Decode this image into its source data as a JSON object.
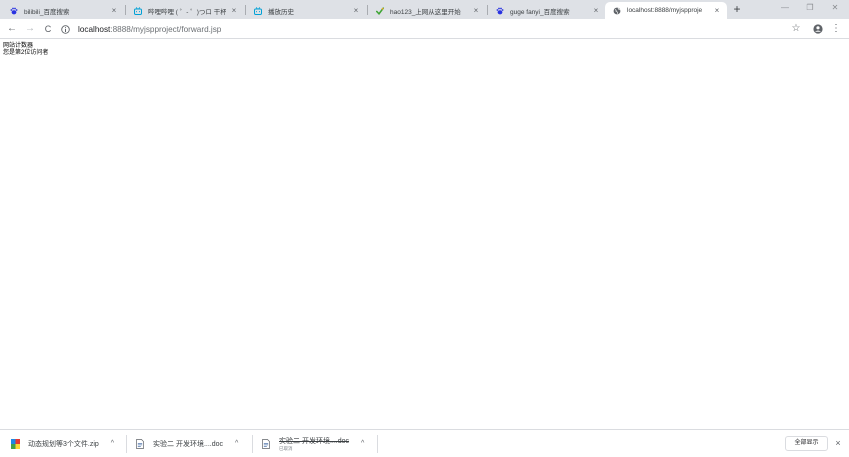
{
  "tabs": [
    {
      "title": "bilibili_百度搜索",
      "icon": "baidu-paw-icon"
    },
    {
      "title": "哔哩哔哩 ( ゜- ゜)つロ 干杯~",
      "icon": "bilibili-tv-icon"
    },
    {
      "title": "播放历史",
      "icon": "bilibili-tv-icon"
    },
    {
      "title": "hao123_上网从这里开始",
      "icon": "hao123-icon"
    },
    {
      "title": "guge fanyi_百度搜索",
      "icon": "baidu-paw-icon"
    },
    {
      "title": "localhost:8888/myjspproje",
      "icon": "globe-icon"
    }
  ],
  "tab_close_glyph": "×",
  "new_tab_glyph": "+",
  "window_controls": {
    "minimize": "—",
    "restore": "❐",
    "close": "✕"
  },
  "nav": {
    "back": "←",
    "forward": "→",
    "reload": "C"
  },
  "address_bar": {
    "host": "localhost",
    "path": ":8888/myjspproject/forward.jsp"
  },
  "toolbar_icons": {
    "bookmark": "☆",
    "menu": "⋮"
  },
  "page": {
    "line1": "网站计数器",
    "line2": "您是第2位访问者"
  },
  "downloads": [
    {
      "name": "动态规划等3个文件.zip",
      "status": "",
      "caret": "^"
    },
    {
      "name": "实验二 开发环境....doc",
      "status": "",
      "caret": "^"
    },
    {
      "name": "实验二 开发环境....doc",
      "status": "已取消",
      "caret": "^"
    }
  ],
  "downloads_bar": {
    "show_all": "全部显示",
    "close": "×"
  },
  "colors": {
    "tabstrip": "#dee1e6",
    "active_tab": "#ffffff",
    "baidu_blue": "#2932e1",
    "bilibili_blue": "#00a1d6"
  }
}
